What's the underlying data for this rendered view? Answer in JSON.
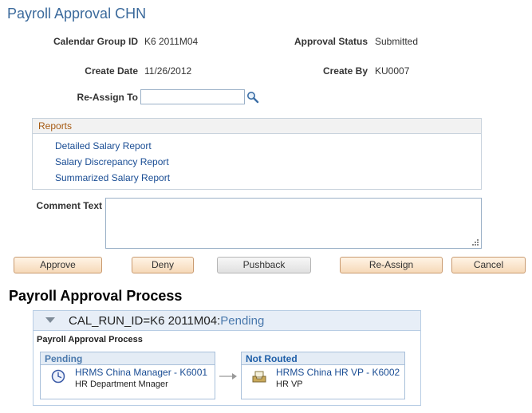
{
  "page": {
    "title": "Payroll Approval CHN"
  },
  "fields": {
    "calendar_group_id": {
      "label": "Calendar Group ID",
      "value": "K6 2011M04"
    },
    "approval_status": {
      "label": "Approval Status",
      "value": "Submitted"
    },
    "create_date": {
      "label": "Create Date",
      "value": "11/26/2012"
    },
    "create_by": {
      "label": "Create By",
      "value": "KU0007"
    },
    "reassign_to": {
      "label": "Re-Assign To",
      "value": ""
    }
  },
  "reports": {
    "header": "Reports",
    "links": [
      "Detailed Salary Report",
      "Salary Discrepancy Report",
      "Summarized Salary Report"
    ]
  },
  "comment": {
    "label": "Comment Text",
    "value": ""
  },
  "buttons": {
    "approve": "Approve",
    "deny": "Deny",
    "pushback": "Pushback",
    "reassign": "Re-Assign",
    "cancel": "Cancel"
  },
  "process": {
    "section_title": "Payroll Approval Process",
    "header_prefix": "CAL_RUN_ID=K6 2011M04:",
    "header_status": "Pending",
    "subtitle": "Payroll Approval Process",
    "steps": [
      {
        "status": "Pending",
        "approver": "HRMS China Manager - K6001",
        "role": "HR Department Mnager",
        "icon": "clock-icon",
        "status_color": "#4a79ad"
      },
      {
        "status": "Not Routed",
        "approver": "HRMS China HR VP - K6002",
        "role": "HR VP",
        "icon": "inbox-tray-icon",
        "status_color": "#1f5fa8"
      }
    ]
  },
  "colors": {
    "title": "#3b6a9c",
    "link": "#1a4d94",
    "reports_header": "#a65a12",
    "button_border": "#c99a6f"
  }
}
